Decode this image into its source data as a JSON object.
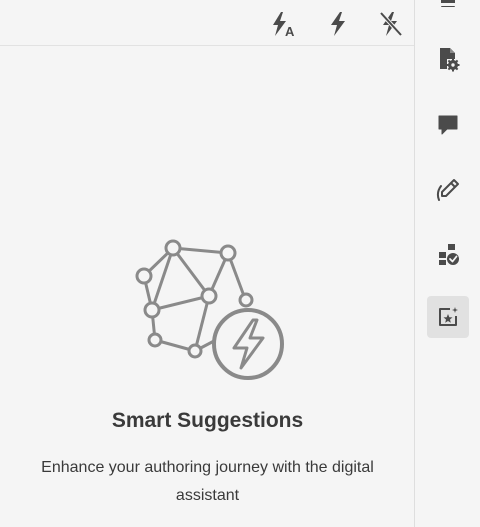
{
  "toolbar": {
    "buttons": [
      {
        "icon": "lightning-a-icon"
      },
      {
        "icon": "lightning-icon"
      },
      {
        "icon": "lightning-off-icon"
      }
    ],
    "letter_badge": "A"
  },
  "rail": {
    "items": [
      {
        "icon": "document-settings-icon",
        "selected": false
      },
      {
        "icon": "comment-icon",
        "selected": false
      },
      {
        "icon": "pen-icon",
        "selected": false
      },
      {
        "icon": "blocks-check-icon",
        "selected": false
      },
      {
        "icon": "smart-suggestions-icon",
        "selected": true
      }
    ]
  },
  "empty_state": {
    "title": "Smart Suggestions",
    "description": "Enhance your authoring journey with the digital assistant",
    "illustration_icon": "network-lightning-icon"
  },
  "colors": {
    "icon": "#4b4b4b",
    "illustration": "#8a8a8a",
    "background": "#f5f5f5",
    "selected_bg": "#e1e1e1"
  }
}
